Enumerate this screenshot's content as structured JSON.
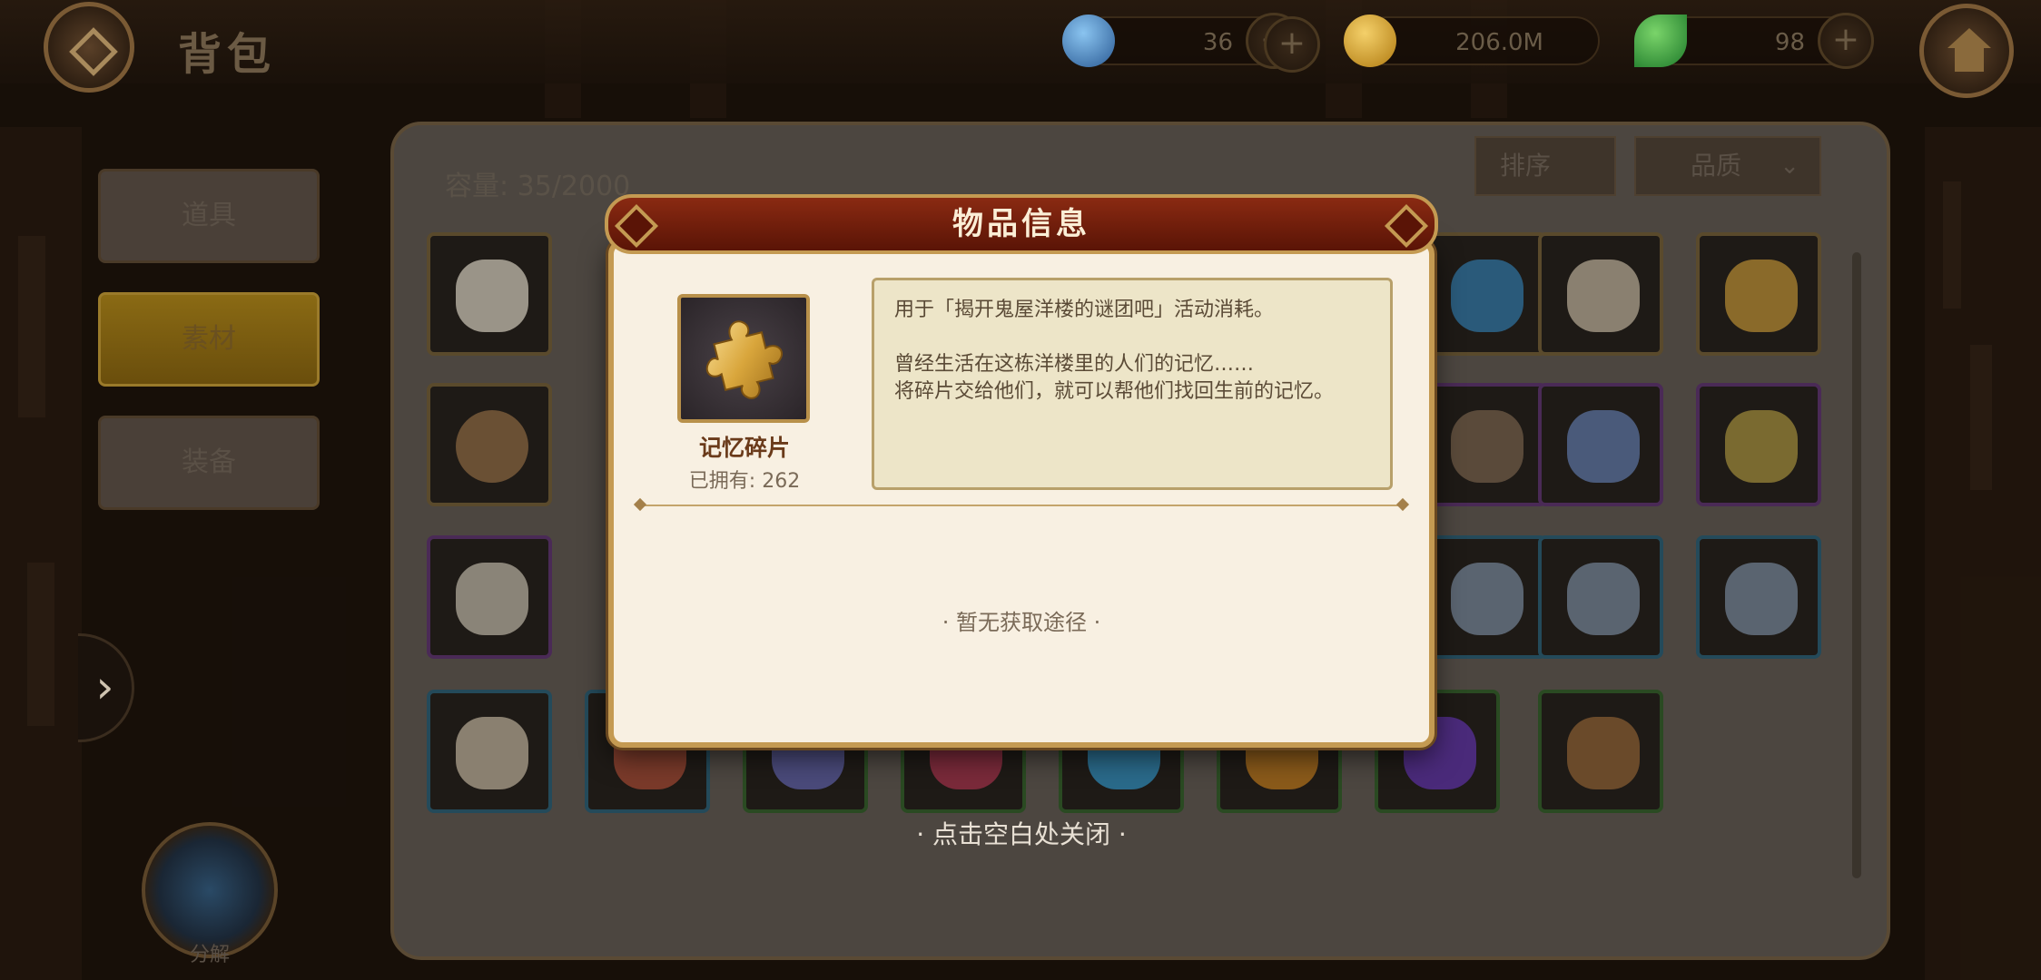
{
  "topbar": {
    "title": "背包",
    "resources": [
      {
        "name": "diamond",
        "value": "36",
        "color": "#3a7ac4"
      },
      {
        "name": "gold",
        "value": "206.0M",
        "color": "#d4a020"
      },
      {
        "name": "leaf",
        "value": "98",
        "color": "#3aa040"
      }
    ]
  },
  "categories": [
    "道具",
    "素材",
    "装备"
  ],
  "decompose_label": "分解",
  "inventory": {
    "capacity": "容量: 35/2000",
    "sort_label": "排序",
    "quality_label": "品质"
  },
  "popup": {
    "title": "物品信息",
    "item": {
      "name": "记忆碎片",
      "owned_label": "已拥有:",
      "owned_value": "262",
      "icon": "puzzle-piece-icon"
    },
    "description": {
      "line1": "用于「揭开鬼屋洋楼的谜团吧」活动消耗。",
      "line2": "曾经生活在这栋洋楼里的人们的记忆……",
      "line3": "将碎片交给他们，就可以帮他们找回生前的记忆。"
    },
    "no_source": "· 暂无获取途径 ·"
  },
  "close_hint": "· 点击空白处关闭 ·",
  "colors": {
    "accent": "#c49a52",
    "banner": "#8a2a12"
  }
}
